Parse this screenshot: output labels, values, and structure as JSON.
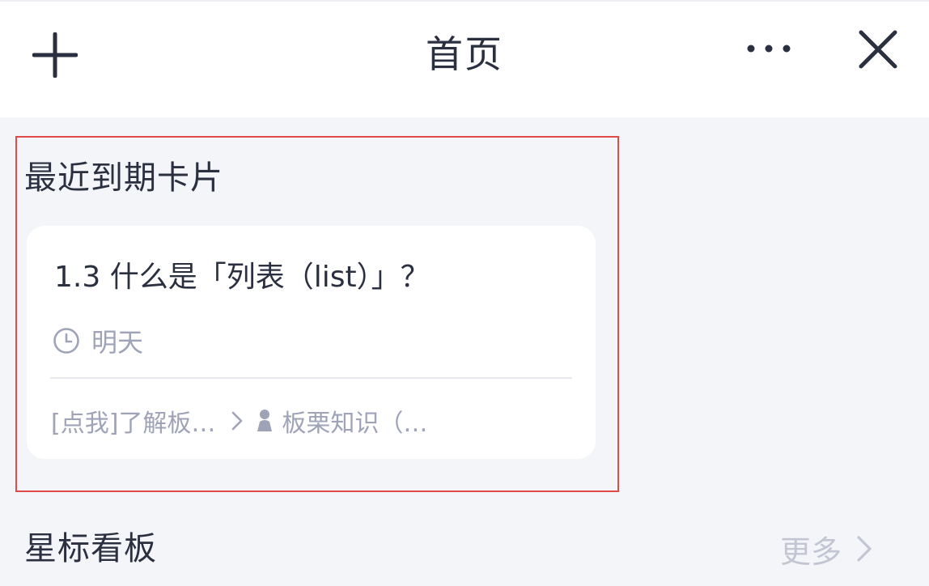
{
  "header": {
    "title": "首页",
    "add_icon": "plus-icon",
    "more_icon": "ellipsis-icon",
    "close_icon": "close-icon"
  },
  "recent_due": {
    "section_title": "最近到期卡片",
    "cards": [
      {
        "title": "1.3 什么是「列表（list）」？",
        "due_icon": "clock-icon",
        "due": "明天",
        "path_parent": "[点我]了解板…",
        "path_separator_icon": "chevron-right-icon",
        "path_board_icon": "person-icon",
        "path_board": "板栗知识（…"
      }
    ]
  },
  "starred_boards": {
    "section_title": "星标看板",
    "more_label": "更多",
    "more_icon": "chevron-right-icon"
  },
  "colors": {
    "background": "#f4f5f9",
    "card": "#ffffff",
    "text_primary": "#2b3040",
    "text_secondary": "#9ea3b8",
    "text_muted": "#c3c6d2",
    "highlight_border": "#e24a4a"
  }
}
